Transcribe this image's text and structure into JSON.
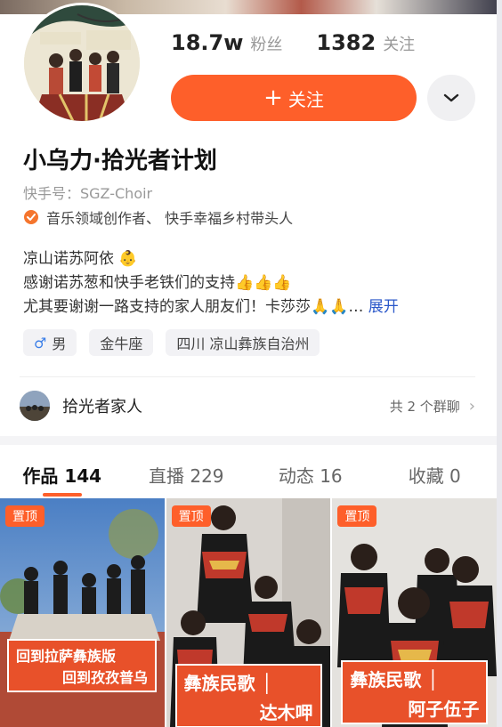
{
  "profile": {
    "followers_num": "18.7w",
    "followers_label": "粉丝",
    "following_num": "1382",
    "following_label": "关注",
    "follow_button": "关注",
    "name": "小乌力·拾光者计划",
    "kuaishou_id": "快手号：SGZ-Choir",
    "certification": "音乐领域创作者、 快手幸福乡村带头人",
    "bio_line1": "凉山诺苏阿依 👶",
    "bio_line2": "感谢诺苏葱和快手老铁们的支持👍👍👍",
    "bio_line3": "尤其要谢谢一路支持的家人朋友们！卡莎莎🙏🙏…",
    "bio_expand": "展开",
    "tags": [
      "男",
      "金牛座",
      "四川 凉山彝族自治州"
    ]
  },
  "group": {
    "title": "拾光者家人",
    "count": "共 2 个群聊"
  },
  "tabs": [
    {
      "label": "作品 144"
    },
    {
      "label": "直播 229"
    },
    {
      "label": "动态 16"
    },
    {
      "label": "收藏 0"
    }
  ],
  "videos": [
    {
      "pin": "置顶",
      "caption_l1": "回到拉萨彝族版",
      "caption_l2": "回到孜孜普乌"
    },
    {
      "pin": "置顶",
      "caption_l1": "彝族民歌 │",
      "caption_l2": "达木呷"
    },
    {
      "pin": "置顶",
      "caption_l1": "彝族民歌 │",
      "caption_l2": "阿子伍子"
    }
  ],
  "colors": {
    "accent": "#fe5f2a",
    "link": "#2a57c9"
  },
  "icons": [
    "chevron-down-icon",
    "plus-icon",
    "certification-icon",
    "male-icon",
    "chevron-right-icon"
  ]
}
